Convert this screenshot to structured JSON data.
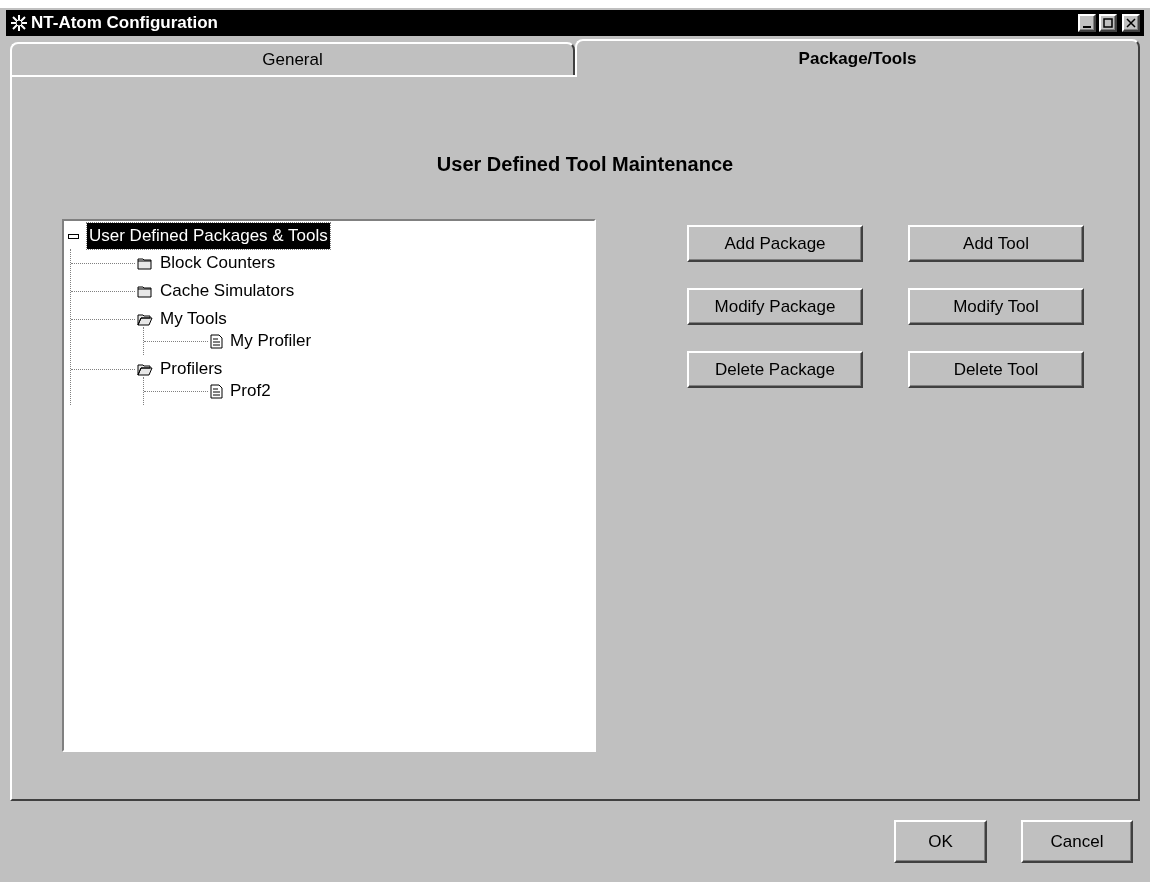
{
  "window": {
    "title": "NT-Atom Configuration"
  },
  "tabs": [
    {
      "label": "General",
      "selected": false
    },
    {
      "label": "Package/Tools",
      "selected": true
    }
  ],
  "heading": "User Defined Tool Maintenance",
  "tree": {
    "label": "User Defined Packages & Tools",
    "expanded": true,
    "selected": true,
    "children": [
      {
        "label": "Block Counters",
        "kind": "folder",
        "expanded": false,
        "selected": false
      },
      {
        "label": "Cache Simulators",
        "kind": "folder",
        "expanded": false,
        "selected": false
      },
      {
        "label": "My Tools",
        "kind": "folder",
        "expanded": true,
        "selected": false,
        "children": [
          {
            "label": "My Profiler",
            "kind": "document",
            "selected": false
          }
        ]
      },
      {
        "label": "Profilers",
        "kind": "folder",
        "expanded": true,
        "selected": false,
        "children": [
          {
            "label": "Prof2",
            "kind": "document",
            "selected": false
          }
        ]
      }
    ]
  },
  "package_buttons": [
    "Add Package",
    "Modify Package",
    "Delete Package"
  ],
  "tool_buttons": [
    "Add Tool",
    "Modify Tool",
    "Delete Tool"
  ],
  "dialog_buttons": [
    "OK",
    "Cancel"
  ]
}
